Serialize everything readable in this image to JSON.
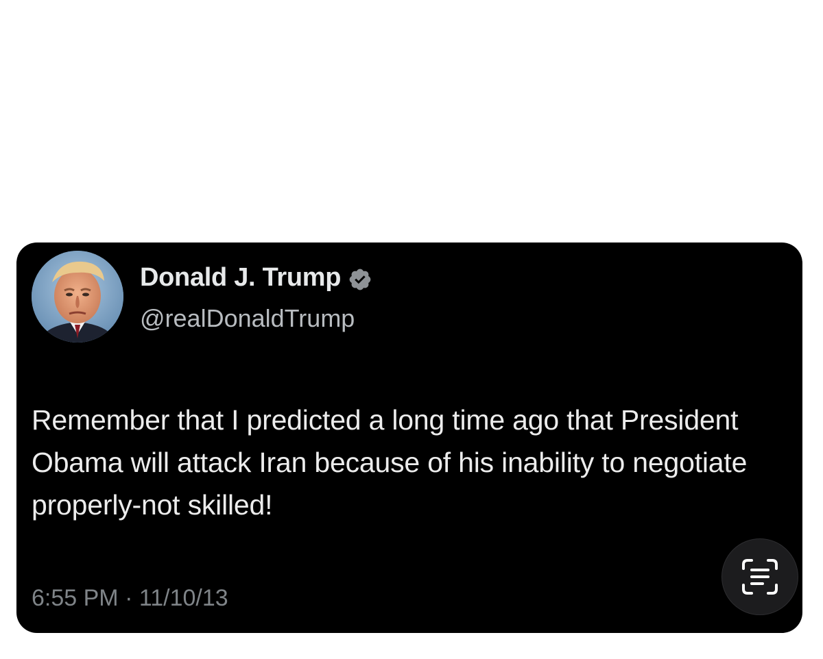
{
  "tweet": {
    "author_name": "Donald J. Trump",
    "author_handle": "@realDonaldTrump",
    "text": "Remember that I predicted a long time ago that President Obama will attack Iran because of his inability to negotiate properly-not skilled!",
    "time": "6:55 PM",
    "separator": "·",
    "date": "11/10/13",
    "verified_icon": "verified-badge-icon",
    "avatar": "profile-photo"
  },
  "overlay": {
    "live_text_icon": "live-text-icon"
  },
  "colors": {
    "card_background": "#000000",
    "page_background": "#ffffff",
    "name_text": "#e7e9ea",
    "handle_text": "#b8bcc0",
    "meta_text": "#7f8488",
    "verified_badge": "#8e9296"
  }
}
